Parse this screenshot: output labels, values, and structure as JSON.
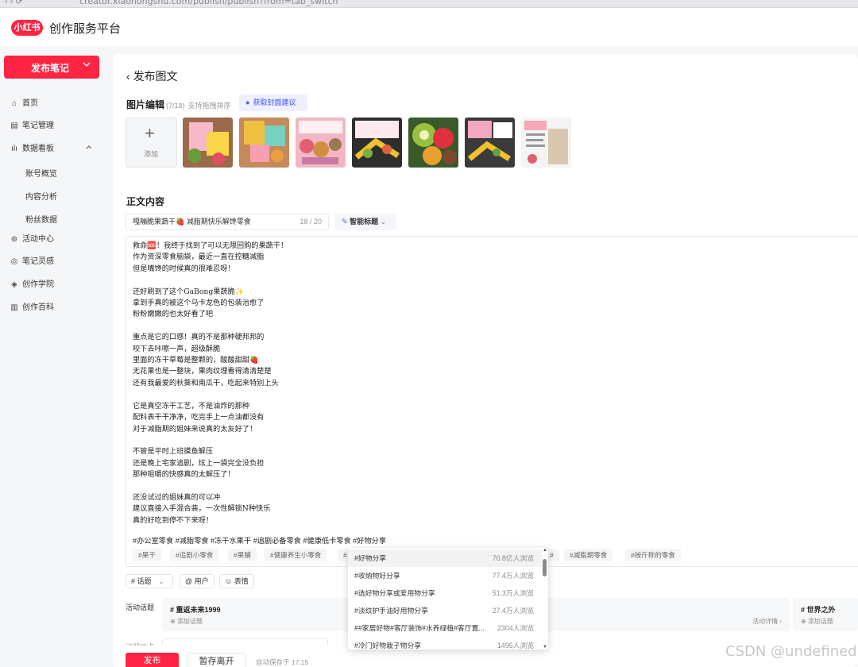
{
  "browser": {
    "url": "creator.xiaohongshu.com/publish/publish?from=tab_switch"
  },
  "header": {
    "logo_text": "小红书",
    "platform": "创作服务平台"
  },
  "sidebar": {
    "publish_button": "发布笔记",
    "items": [
      {
        "label": "首页",
        "icon": "home-icon"
      },
      {
        "label": "笔记管理",
        "icon": "note-icon"
      },
      {
        "label": "数据看板",
        "icon": "chart-icon"
      },
      {
        "label": "账号概览"
      },
      {
        "label": "内容分析"
      },
      {
        "label": "粉丝数据"
      },
      {
        "label": "活动中心",
        "icon": "activity-icon"
      },
      {
        "label": "笔记灵感",
        "icon": "inspiration-icon"
      },
      {
        "label": "创作学院",
        "icon": "academy-icon"
      },
      {
        "label": "创作百科",
        "icon": "wiki-icon"
      }
    ]
  },
  "main": {
    "back_title": "发布图文",
    "image_edit": {
      "title": "图片编辑",
      "count": "(7/18)",
      "hint": "支持拖拽排序",
      "cover_btn": "获取封面建议",
      "add_label": "添加"
    },
    "content_title": "正文内容",
    "title_input": {
      "value": "嘎嘣脆果蔬干🍓 减脂期快乐解馋零食",
      "count": "18 / 20"
    },
    "smart_title": "智能标题",
    "body": "救命🆘！我终于找到了可以无限回购的果蔬干！\n作为资深零食脑袋，最近一直在控糖减脂\n但是嘴馋的时候真的很难忍呀！\n\n还好刷到了这个GaBong果蔬脆✨\n拿到手真的被这个马卡龙色的包装治愈了\n粉粉嫩嫩的也太好看了吧\n\n重点是它的口感！真的不是那种硬邦邦的\n咬下去咔嚓一声，超级酥脆\n里面的冻干草莓是整颗的，酸酸甜甜🍓\n无花果也是一整块，果肉纹理看得清清楚楚\n还有我最爱的秋葵和南瓜干，吃起来特别上头\n\n它是真空冻干工艺，不是油炸的那种\n配料表干干净净，吃完手上一点油都没有\n对于减脂期的姐妹来说真的太友好了！\n\n不管是平时上班摸鱼解压\n还是晚上宅家追剧，炫上一袋完全没负担\n那种咀嚼的快感真的太解压了！\n\n还没试过的姐妹真的可以冲\n建议直接入手混合装，一次性解锁N种快乐\n真的好吃到停不下来呀！",
    "tag_line": "#办公室零食 #减脂零食 #冻干水果干 #追剧必备零食 #健康低卡零食 #好物分享",
    "chips": [
      "#果干",
      "#追剧小零食",
      "#果脯",
      "#健康养生小零食",
      "#",
      "#",
      "#减脂期零食",
      "#按斤称的零食"
    ],
    "tools": {
      "topic": "话题",
      "user": "用户",
      "emoji": "表情"
    },
    "activity": {
      "label": "活动话题",
      "cards": [
        {
          "title": "重返未来1999",
          "add": "添加话题",
          "detail": "活动详情"
        },
        {
          "title": "世界之外",
          "add": "添加话题"
        }
      ]
    },
    "partial_label": "证朋地点",
    "footer": {
      "publish": "发布",
      "save": "暂存离开",
      "autosave": "自动保存于 17:15"
    }
  },
  "dropdown": {
    "items": [
      {
        "name": "#好物分享",
        "views": "70.8亿人浏览"
      },
      {
        "name": "#收纳物好分享",
        "views": "77.4万人浏览"
      },
      {
        "name": "#选好物分享或爱用物分享",
        "views": "51.3万人浏览"
      },
      {
        "name": "#淡纹护手油好用物分享",
        "views": "27.4万人浏览"
      },
      {
        "name": "##家居好物#客厅装饰#水养绿植#客厅置...",
        "views": "2304人浏览"
      },
      {
        "name": "#冷门好物栽子物分享",
        "views": "1495人浏览"
      }
    ]
  },
  "watermark": "CSDN @undefined",
  "colors": {
    "accent": "#ff2442",
    "link": "#3b4cff"
  }
}
